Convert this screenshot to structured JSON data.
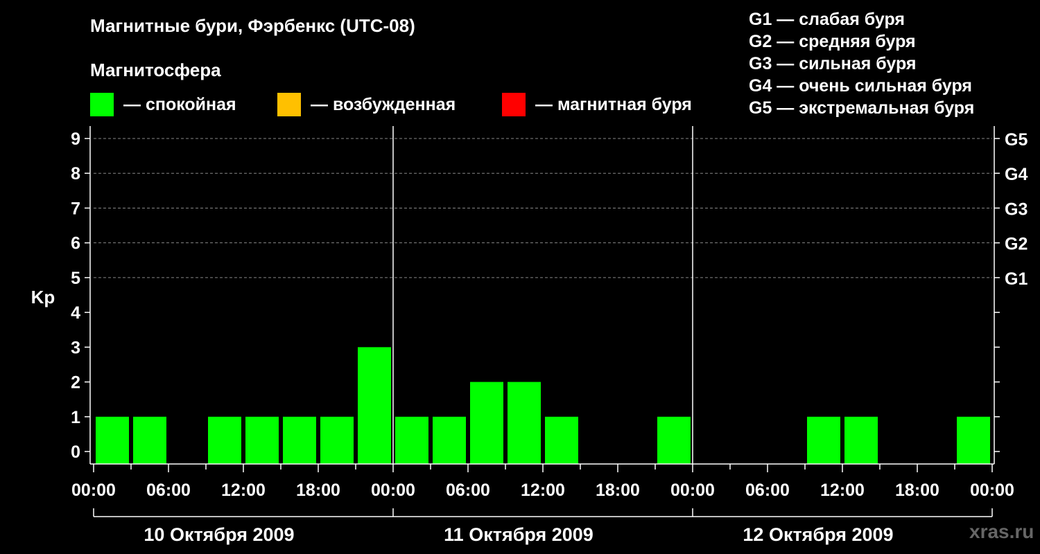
{
  "title": "Магнитные бури, Фэрбенкс (UTC-08)",
  "subtitle": "Магнитосфера",
  "legend": [
    {
      "label": "— спокойная",
      "color": "#00ff00"
    },
    {
      "label": "— возбужденная",
      "color": "#ffc000"
    },
    {
      "label": "— магнитная буря",
      "color": "#ff0000"
    }
  ],
  "g_legend": [
    "G1 — слабая буря",
    "G2 — средняя буря",
    "G3 — сильная буря",
    "G4 — очень сильная буря",
    "G5 — экстремальная буря"
  ],
  "watermark": "xras.ru",
  "chart_data": {
    "type": "bar",
    "ylabel": "Kp",
    "ylim": [
      0,
      9
    ],
    "y_ticks": [
      "0",
      "1",
      "2",
      "3",
      "4",
      "5",
      "6",
      "7",
      "8",
      "9"
    ],
    "right_ticks": [
      {
        "value": 5,
        "label": "G1"
      },
      {
        "value": 6,
        "label": "G2"
      },
      {
        "value": 7,
        "label": "G3"
      },
      {
        "value": 8,
        "label": "G4"
      },
      {
        "value": 9,
        "label": "G5"
      }
    ],
    "x_tick_labels": [
      "00:00",
      "06:00",
      "12:00",
      "18:00",
      "00:00",
      "06:00",
      "12:00",
      "18:00",
      "00:00",
      "06:00",
      "12:00",
      "18:00",
      "00:00"
    ],
    "days": [
      "10 Октября 2009",
      "11 Октября 2009",
      "12 Октября 2009"
    ],
    "grid": "dashed horizontal at Kp 5–9",
    "bar_color": "#00ff00",
    "bars_hours": [
      1.5,
      4.5,
      10.5,
      13.5,
      16.5,
      19.5,
      22.5,
      25.5,
      28.5,
      31.5,
      34.5,
      37.5,
      46.5,
      58.5,
      61.5,
      70.5
    ],
    "values": [
      1,
      1,
      1,
      1,
      1,
      1,
      3,
      1,
      1,
      2,
      2,
      1,
      1,
      1,
      1,
      1
    ]
  }
}
